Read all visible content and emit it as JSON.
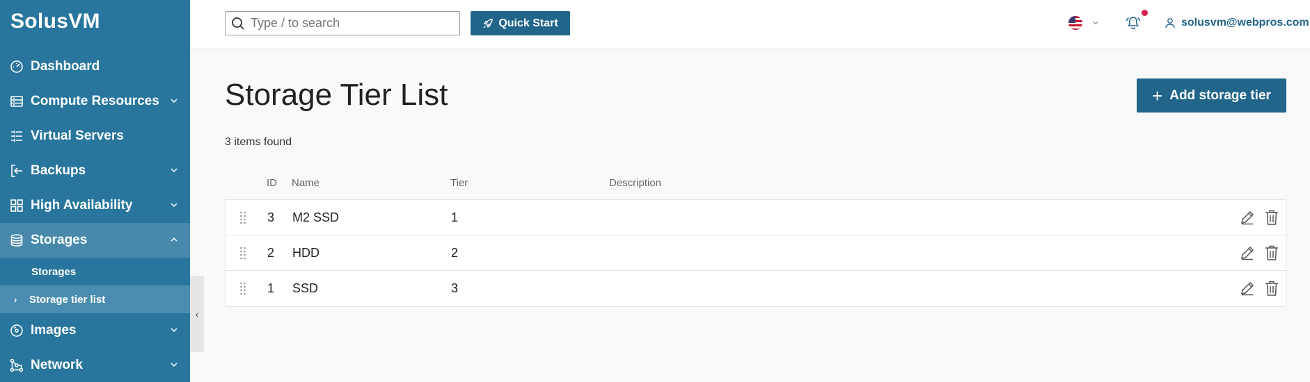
{
  "app": {
    "name": "SolusVM"
  },
  "sidebar": {
    "items": [
      {
        "label": "Dashboard",
        "icon": "dashboard-icon",
        "expandable": false
      },
      {
        "label": "Compute Resources",
        "icon": "server-icon",
        "expandable": true
      },
      {
        "label": "Virtual Servers",
        "icon": "virtual-servers-icon",
        "expandable": false
      },
      {
        "label": "Backups",
        "icon": "backup-icon",
        "expandable": true
      },
      {
        "label": "High Availability",
        "icon": "grid-icon",
        "expandable": true
      },
      {
        "label": "Storages",
        "icon": "database-icon",
        "expandable": true,
        "open": true,
        "children": [
          {
            "label": "Storages"
          },
          {
            "label": "Storage tier list",
            "active": true
          }
        ]
      },
      {
        "label": "Images",
        "icon": "disc-icon",
        "expandable": true
      },
      {
        "label": "Network",
        "icon": "network-icon",
        "expandable": true
      }
    ],
    "colors": {
      "background": "#28769e",
      "active": "#4b8db0"
    }
  },
  "topbar": {
    "search_placeholder": "Type / to search",
    "quick_start_label": "Quick Start",
    "language": "en-US",
    "user_email": "solusvm@webpros.com"
  },
  "main": {
    "title": "Storage Tier List",
    "add_button_label": "Add storage tier",
    "items_found": "3 items found",
    "columns": {
      "id": "ID",
      "name": "Name",
      "tier": "Tier",
      "description": "Description"
    },
    "rows": [
      {
        "id": "3",
        "name": "M2 SSD",
        "tier": "1",
        "description": ""
      },
      {
        "id": "2",
        "name": "HDD",
        "tier": "2",
        "description": ""
      },
      {
        "id": "1",
        "name": "SSD",
        "tier": "3",
        "description": ""
      }
    ]
  },
  "colors": {
    "primary": "#21658a",
    "notification": "#d6244b"
  }
}
